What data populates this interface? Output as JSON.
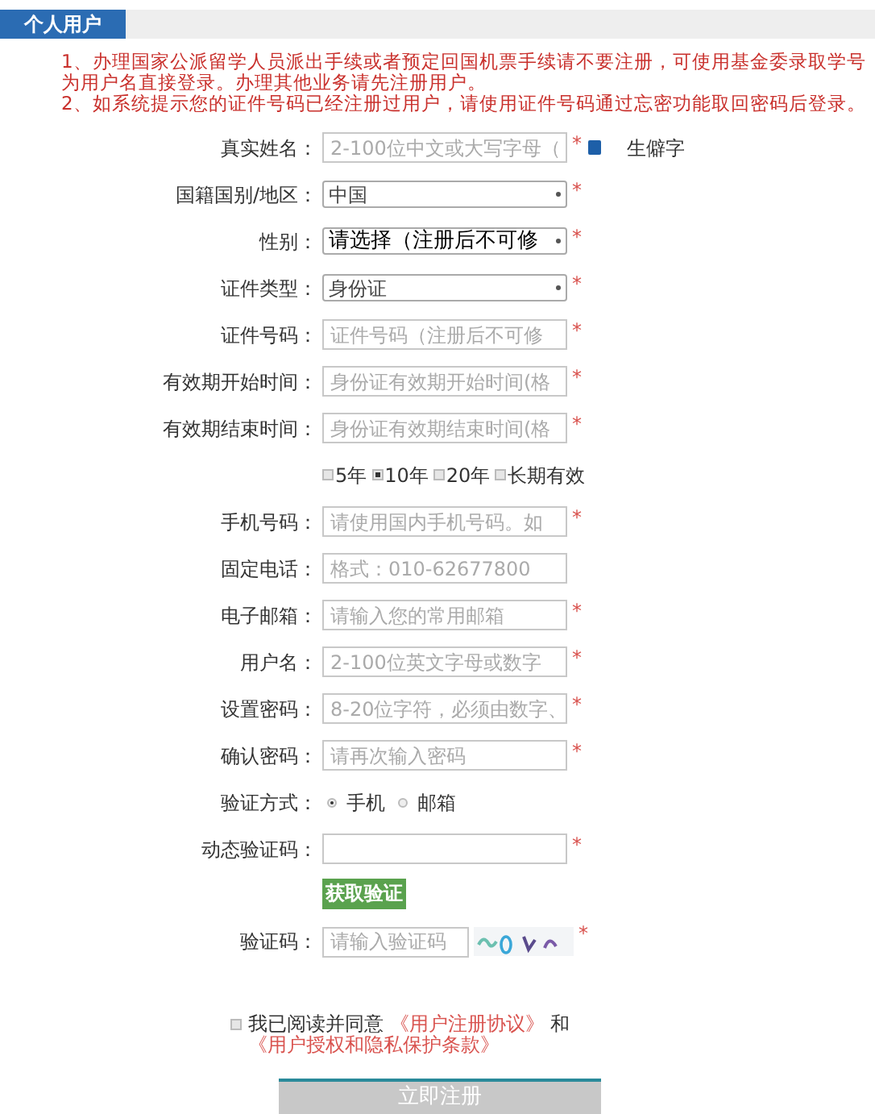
{
  "tab": {
    "label": "个人用户",
    "selected": true
  },
  "notices": [
    "1、办理国家公派留学人员派出手续或者预定回国机票手续请不要注册，可使用基金委录取学号为用户名直接登录。办理其他业务请先注册用户。",
    "2、如系统提示您的证件号码已经注册过用户，请使用证件号码通过忘密功能取回密码后登录。"
  ],
  "rows": [
    {
      "kind": "input",
      "label": "真实姓名：",
      "placeholder": "2-100位中文或大写字母（",
      "mark": "*",
      "help": "生僻字"
    },
    {
      "kind": "select",
      "label": "国籍国别/地区：",
      "value": "中国",
      "mark": "*"
    },
    {
      "kind": "select",
      "label": "性别：",
      "value": "请选择（注册后不可修",
      "mark": "*",
      "strong": true
    },
    {
      "kind": "select",
      "label": "证件类型：",
      "value": "身份证",
      "mark": "*"
    },
    {
      "kind": "input",
      "label": "证件号码：",
      "placeholder": "证件号码（注册后不可修",
      "mark": "*"
    },
    {
      "kind": "input",
      "label": "有效期开始时间：",
      "placeholder": "身份证有效期开始时间(格",
      "mark": "*"
    },
    {
      "kind": "input",
      "label": "有效期结束时间：",
      "placeholder": "身份证有效期结束时间(格",
      "mark": "*"
    },
    {
      "kind": "checks",
      "options": [
        {
          "label": "5年",
          "checked": false
        },
        {
          "label": "10年",
          "checked": true
        },
        {
          "label": "20年",
          "checked": false
        },
        {
          "label": "长期有效",
          "checked": false
        }
      ]
    },
    {
      "kind": "input",
      "label": "手机号码：",
      "placeholder": "请使用国内手机号码。如",
      "mark": "*"
    },
    {
      "kind": "input",
      "label": "固定电话：",
      "placeholder": "格式：010-62677800"
    },
    {
      "kind": "input",
      "label": "电子邮箱：",
      "placeholder": "请输入您的常用邮箱",
      "mark": "*"
    },
    {
      "kind": "input",
      "label": "用户名：",
      "placeholder": "2-100位英文字母或数字",
      "mark": "*"
    },
    {
      "kind": "input",
      "label": "设置密码：",
      "placeholder": "8-20位字符，必须由数字、",
      "mark": "*"
    },
    {
      "kind": "input",
      "label": "确认密码：",
      "placeholder": "请再次输入密码",
      "mark": "*"
    },
    {
      "kind": "radios",
      "label": "验证方式：",
      "options": [
        {
          "label": "手机",
          "selected": true
        },
        {
          "label": "邮箱",
          "selected": false
        }
      ]
    },
    {
      "kind": "input",
      "label": "动态验证码：",
      "mark": "*"
    },
    {
      "kind": "button",
      "label": "获取验证"
    },
    {
      "kind": "captcha",
      "label": "验证码：",
      "placeholder": "请输入验证码",
      "mark": "*"
    }
  ],
  "agreement": {
    "checked": false,
    "text": "我已阅读并同意",
    "link1": "《用户注册协议》",
    "joiner": "和",
    "link2": "《用户授权和隐私保护条款》"
  },
  "submit": "立即注册"
}
